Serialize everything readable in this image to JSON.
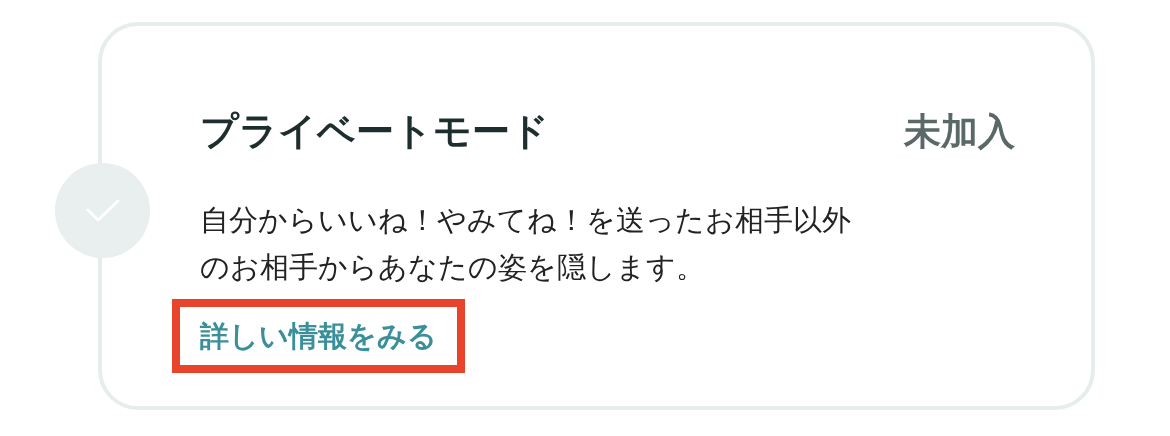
{
  "setting": {
    "title": "プライベートモード",
    "status": "未加入",
    "checked": false,
    "description": "自分からいいね！やみてね！を送ったお相手以外のお相手からあなたの姿を隠します。",
    "link": {
      "label": "詳しい情報をみる",
      "highlighted": true
    }
  }
}
